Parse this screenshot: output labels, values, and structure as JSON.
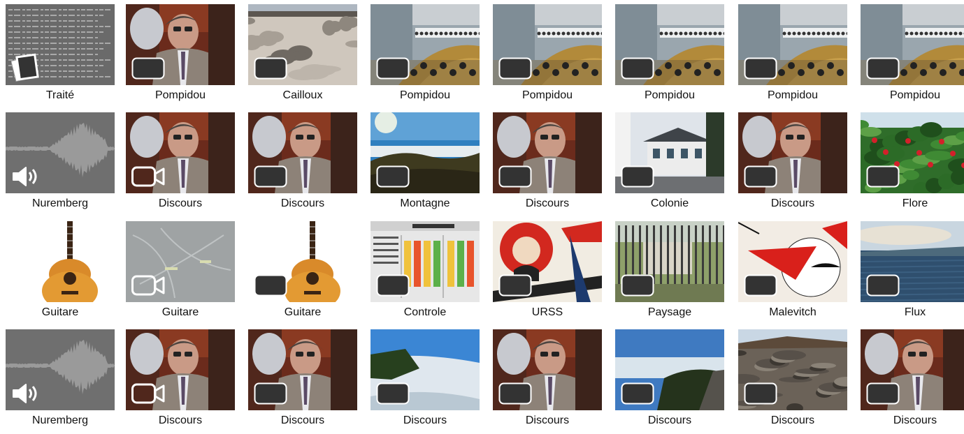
{
  "tiles": [
    {
      "label": "Traité",
      "thumb": "document",
      "badge": "stack-icon"
    },
    {
      "label": "Pompidou",
      "thumb": "speaker",
      "badge": "image-icon"
    },
    {
      "label": "Cailloux",
      "thumb": "rocks",
      "badge": "image-icon"
    },
    {
      "label": "Pompidou",
      "thumb": "assembly",
      "badge": "image-icon"
    },
    {
      "label": "Pompidou",
      "thumb": "assembly",
      "badge": "image-icon"
    },
    {
      "label": "Pompidou",
      "thumb": "assembly",
      "badge": "image-icon"
    },
    {
      "label": "Pompidou",
      "thumb": "assembly",
      "badge": "image-icon"
    },
    {
      "label": "Pompidou",
      "thumb": "assembly",
      "badge": "image-icon"
    },
    {
      "label": "Nuremberg",
      "thumb": "waveform",
      "badge": "speaker-icon"
    },
    {
      "label": "Discours",
      "thumb": "speaker",
      "badge": "video-icon"
    },
    {
      "label": "Discours",
      "thumb": "speaker",
      "badge": "image-icon"
    },
    {
      "label": "Montagne",
      "thumb": "mountain",
      "badge": "image-icon"
    },
    {
      "label": "Discours",
      "thumb": "speaker",
      "badge": "image-icon"
    },
    {
      "label": "Colonie",
      "thumb": "house",
      "badge": "image-icon"
    },
    {
      "label": "Discours",
      "thumb": "speaker",
      "badge": "image-icon"
    },
    {
      "label": "Flore",
      "thumb": "flowers",
      "badge": "image-icon"
    },
    {
      "label": "Guitare",
      "thumb": "guitar",
      "badge": "speaker-icon"
    },
    {
      "label": "Guitare",
      "thumb": "sketch",
      "badge": "video-icon"
    },
    {
      "label": "Guitare",
      "thumb": "guitar",
      "badge": "image-icon"
    },
    {
      "label": "Controle",
      "thumb": "panel",
      "badge": "image-icon"
    },
    {
      "label": "URSS",
      "thumb": "poster",
      "badge": "image-icon"
    },
    {
      "label": "Paysage",
      "thumb": "fence",
      "badge": "image-icon"
    },
    {
      "label": "Malevitch",
      "thumb": "wedge",
      "badge": "image-icon"
    },
    {
      "label": "Flux",
      "thumb": "sea",
      "badge": "image-icon"
    },
    {
      "label": "Nuremberg",
      "thumb": "waveform",
      "badge": "speaker-icon"
    },
    {
      "label": "Discours",
      "thumb": "speaker",
      "badge": "video-icon"
    },
    {
      "label": "Discours",
      "thumb": "speaker",
      "badge": "image-icon"
    },
    {
      "label": "Discours",
      "thumb": "cloudsea",
      "badge": "image-icon"
    },
    {
      "label": "Discours",
      "thumb": "speaker",
      "badge": "image-icon"
    },
    {
      "label": "Discours",
      "thumb": "cliff",
      "badge": "image-icon"
    },
    {
      "label": "Discours",
      "thumb": "lava",
      "badge": "image-icon"
    },
    {
      "label": "Discours",
      "thumb": "speaker",
      "badge": "image-icon"
    }
  ]
}
